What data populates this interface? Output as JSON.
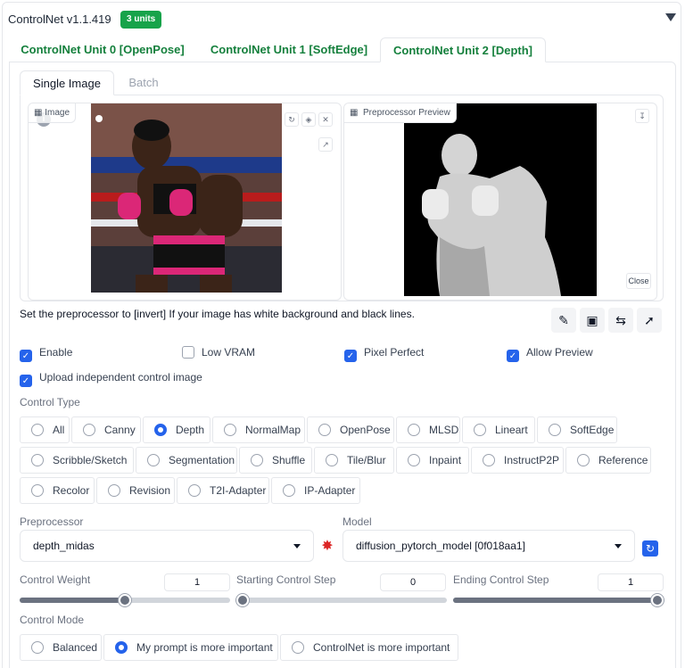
{
  "header": {
    "title": "ControlNet v1.1.419",
    "badge": "3 units"
  },
  "unit_tabs": [
    "ControlNet Unit 0 [OpenPose]",
    "ControlNet Unit 1 [SoftEdge]",
    "ControlNet Unit 2 [Depth]"
  ],
  "image_tabs": [
    "Single Image",
    "Batch"
  ],
  "image_pane": {
    "label": "Image"
  },
  "preview_pane": {
    "label": "Preprocessor Preview",
    "close_label": "Close"
  },
  "note": "Set the preprocessor to [invert] If your image has white background and black lines.",
  "checkboxes": {
    "enable": {
      "label": "Enable",
      "checked": true
    },
    "low_vram": {
      "label": "Low VRAM",
      "checked": false
    },
    "pixel_perfect": {
      "label": "Pixel Perfect",
      "checked": true
    },
    "allow_preview": {
      "label": "Allow Preview",
      "checked": true
    },
    "upload_independent": {
      "label": "Upload independent control image",
      "checked": true
    }
  },
  "control_type": {
    "label": "Control Type",
    "selected": "Depth",
    "row1": [
      "All",
      "Canny",
      "Depth",
      "NormalMap",
      "OpenPose",
      "MLSD",
      "Lineart",
      "SoftEdge"
    ],
    "row2": [
      "Scribble/Sketch",
      "Segmentation",
      "Shuffle",
      "Tile/Blur",
      "Inpaint",
      "InstructP2P",
      "Reference"
    ],
    "row3": [
      "Recolor",
      "Revision",
      "T2I-Adapter",
      "IP-Adapter"
    ]
  },
  "preprocessor": {
    "label": "Preprocessor",
    "value": "depth_midas"
  },
  "model": {
    "label": "Model",
    "value": "diffusion_pytorch_model [0f018aa1]"
  },
  "sliders": {
    "weight": {
      "label": "Control Weight",
      "value": "1",
      "fraction": 0.5
    },
    "start": {
      "label": "Starting Control Step",
      "value": "0",
      "fraction": 0.0
    },
    "end": {
      "label": "Ending Control Step",
      "value": "1",
      "fraction": 1.0
    }
  },
  "control_mode": {
    "label": "Control Mode",
    "options": [
      "Balanced",
      "My prompt is more important",
      "ControlNet is more important"
    ],
    "selected": "My prompt is more important"
  },
  "colors": {
    "accent": "#2563eb",
    "tab_green": "#15803d",
    "badge_green": "#17a34a"
  }
}
